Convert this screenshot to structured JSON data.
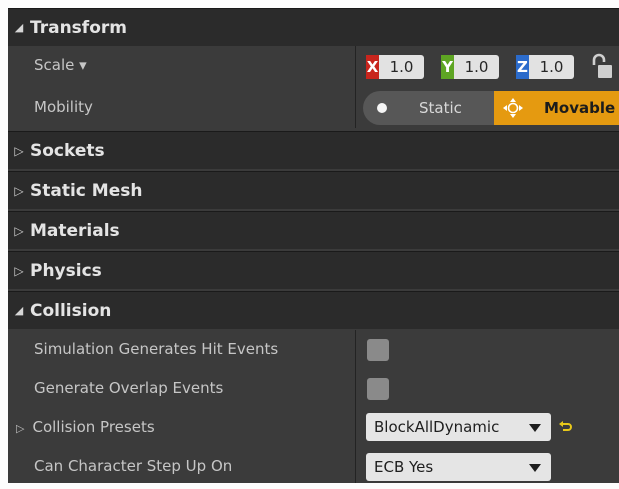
{
  "sections": {
    "transform": "Transform",
    "sockets": "Sockets",
    "static_mesh": "Static Mesh",
    "materials": "Materials",
    "physics": "Physics",
    "collision": "Collision"
  },
  "transform": {
    "scale_label": "Scale ▾",
    "scale": {
      "x_axis": "X",
      "x": "1.0",
      "y_axis": "Y",
      "y": "1.0",
      "z_axis": "Z",
      "z": "1.0"
    },
    "mobility_label": "Mobility",
    "mobility_static": "Static",
    "mobility_movable": "Movable",
    "mobility_selected": "Movable"
  },
  "collision": {
    "sim_hit_label": "Simulation Generates Hit Events",
    "sim_hit_checked": false,
    "overlap_label": "Generate Overlap Events",
    "overlap_checked": false,
    "presets_label": "Collision Presets",
    "presets_value": "BlockAllDynamic",
    "step_up_label": "Can Character Step Up On",
    "step_up_value": "ECB Yes"
  },
  "icons": {
    "expanded": "expanded-triangle-icon",
    "collapsed": "collapsed-triangle-icon",
    "lock": "unlocked-padlock-icon",
    "movable": "move-arrows-icon",
    "reset": "reset-to-default-arrow-icon",
    "dropdown": "chevron-down-icon"
  },
  "colors": {
    "panel_bg": "#3b3b3b",
    "header_bg": "#2b2b2b",
    "x_axis": "#c8251d",
    "y_axis": "#5ea523",
    "z_axis": "#2b6bcb",
    "movable_accent": "#e59a10",
    "reset_icon": "#e8c81a"
  }
}
